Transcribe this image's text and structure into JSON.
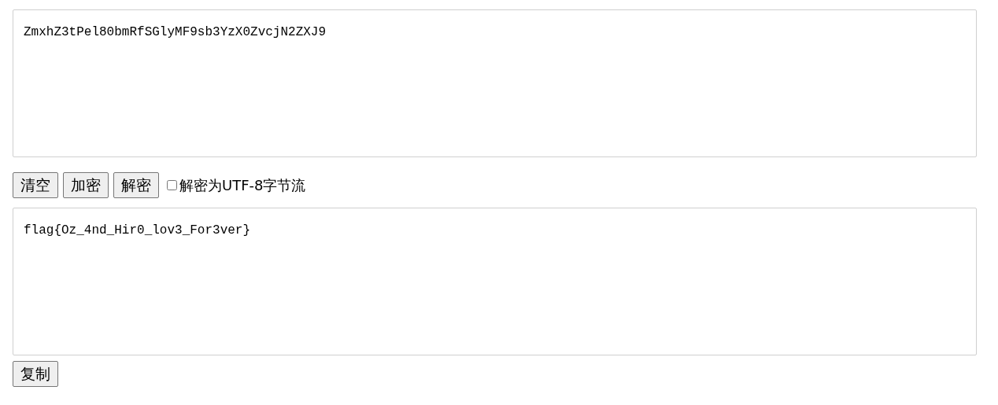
{
  "input": {
    "value": "ZmxhZ3tPel80bmRfSGlyMF9sb3YzX0ZvcjN2ZXJ9"
  },
  "buttons": [
    {
      "label": "清空"
    },
    {
      "label": "加密"
    },
    {
      "label": "解密"
    }
  ],
  "utf8_option": {
    "label": "解密为UTF-8字节流",
    "checked": false
  },
  "output": {
    "value": "flag{Oz_4nd_Hir0_lov3_For3ver}"
  },
  "copy_button": {
    "label": "复制"
  }
}
